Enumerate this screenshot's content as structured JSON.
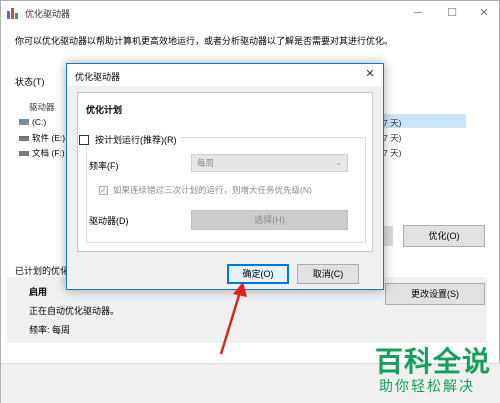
{
  "main_window": {
    "title": "优化驱动器",
    "intro_text": "你可以优化驱动器以帮助计算机更高效地运行，或者分析驱动器以了解是否需要对其进行优化。",
    "status_label": "状态(T)",
    "drive_header": "驱动器",
    "drives": [
      {
        "name": "(C:)",
        "icon": "windows-drive-icon"
      },
      {
        "name": "软件 (E:)",
        "icon": "drive-icon"
      },
      {
        "name": "文档 (F:)",
        "icon": "drive-icon"
      }
    ],
    "right_fragments": [
      "7 天)",
      "7 天)",
      "7 天)"
    ],
    "optimize_button": "优化(O)",
    "scheduled_label": "已计划的优化",
    "schedule_status": "启用",
    "schedule_running": "正在自动优化驱动器。",
    "schedule_frequency": "频率: 每周",
    "change_settings_button": "更改设置(S)"
  },
  "dialog": {
    "title": "优化驱动器",
    "close_symbol": "✕",
    "heading": "优化计划",
    "run_on_schedule_label": "按计划运行(推荐)(R)",
    "run_on_schedule_checked": false,
    "frequency_label": "频率(F)",
    "frequency_value": "每周",
    "notify_label": "如果连续错过三次计划的运行，则增大任务优先级(N)",
    "notify_checked": true,
    "drives_label": "驱动器(D)",
    "choose_button": "选择(H)",
    "ok_button": "确定(O)",
    "cancel_button": "取消(C)"
  },
  "watermark": {
    "big": "百科全说",
    "small": "助你轻松解决"
  },
  "colors": {
    "accent": "#0078d7",
    "dialog_border": "#1979ca",
    "selection": "#cce4f7",
    "arrow": "#e02020",
    "watermark": "#14a05a"
  }
}
